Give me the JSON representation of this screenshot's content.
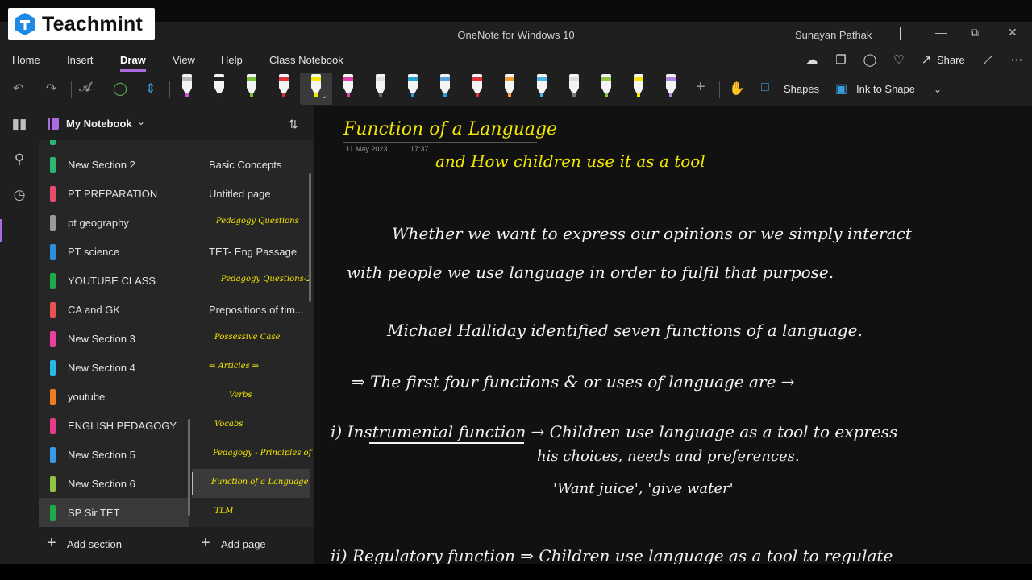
{
  "brand": {
    "name": "Teachmint"
  },
  "window": {
    "title": "OneNote for Windows 10",
    "user": "Sunayan Pathak"
  },
  "menu": [
    "Home",
    "Insert",
    "Draw",
    "View",
    "Help",
    "Class Notebook"
  ],
  "menu_active": "Draw",
  "ribbon_right": {
    "share": "Share"
  },
  "toolbar": {
    "shapes": "Shapes",
    "ink_to_shape": "Ink to Shape",
    "pens": [
      {
        "band": "#b9b9b9",
        "point": "#c35bd0"
      },
      {
        "band": "#222222",
        "point": "#222222"
      },
      {
        "band": "#7bbd3a",
        "point": "#7bbd3a"
      },
      {
        "band": "#e0303a",
        "point": "#e0303a"
      },
      {
        "band": "#f3e600",
        "point": "#f3e600"
      },
      {
        "band": "#e23fa9",
        "point": "#e23fa9"
      },
      {
        "band": "#dddddd",
        "point": "#666666"
      },
      {
        "band": "#2a9fd6",
        "point": "#2a9fd6"
      },
      {
        "band": "#5aa0e0",
        "point": "#2a9fd6"
      },
      {
        "band": "#e0303a",
        "point": "#e0303a"
      },
      {
        "band": "#f29d38",
        "point": "#f29d38"
      },
      {
        "band": "#47b6e8",
        "point": "#47b6e8"
      },
      {
        "band": "#dddddd",
        "point": "#777777"
      },
      {
        "band": "#8dc63f",
        "point": "#8dc63f"
      },
      {
        "band": "#f3e600",
        "point": "#f3e600"
      },
      {
        "band": "#b088e0",
        "point": "#b088e0"
      }
    ]
  },
  "notebook": {
    "title": "My Notebook"
  },
  "sections": [
    {
      "label": "New Section 2",
      "color": "#2bb673"
    },
    {
      "label": "PT PREPARATION",
      "color": "#e94b6d"
    },
    {
      "label": "pt geography",
      "color": "#9a9a9a"
    },
    {
      "label": "PT science",
      "color": "#2a8fe0"
    },
    {
      "label": "YOUTUBE CLASS",
      "color": "#1faa4a"
    },
    {
      "label": "CA and GK",
      "color": "#e8524f"
    },
    {
      "label": "New Section 3",
      "color": "#e83fa0"
    },
    {
      "label": "New Section 4",
      "color": "#29b6e8"
    },
    {
      "label": "youtube",
      "color": "#f07c22"
    },
    {
      "label": "ENGLISH PEDAGOGY",
      "color": "#e63b8a"
    },
    {
      "label": "New Section 5",
      "color": "#3b9ae8"
    },
    {
      "label": "New Section 6",
      "color": "#8dc63f"
    },
    {
      "label": "SP Sir TET",
      "color": "#1faa4a"
    }
  ],
  "sections_add": "Add section",
  "pages": [
    {
      "label": "Basic Concepts",
      "type": "text"
    },
    {
      "label": "Untitled page",
      "type": "text"
    },
    {
      "label": "Pedagogy Questions",
      "type": "hand"
    },
    {
      "label": "TET- Eng Passage",
      "type": "text"
    },
    {
      "label": "Pedagogy Questions-2",
      "type": "hand"
    },
    {
      "label": "Prepositions of tim...",
      "type": "text"
    },
    {
      "label": "Possessive Case",
      "type": "hand"
    },
    {
      "label": "⇐ Articles ⇒",
      "type": "hand"
    },
    {
      "label": "Verbs",
      "type": "hand"
    },
    {
      "label": "Vocabs",
      "type": "hand"
    },
    {
      "label": "Pedagogy - Principles of Lan",
      "type": "hand"
    },
    {
      "label": "Function of a Language",
      "type": "hand"
    },
    {
      "label": "TLM",
      "type": "hand"
    }
  ],
  "pages_add": "Add page",
  "note": {
    "title": "Function of a Language",
    "date": "11 May 2023",
    "time": "17:37",
    "subtitle": "and How children use it as a tool",
    "lines": [
      "Whether we want to express our opinions or we simply interact",
      "with people we use language in order to fulfil that purpose.",
      "Michael Halliday identified seven functions of a language.",
      "⇒ The first four functions & or uses of language are →",
      "i) Instrumental function → Children use language as a tool to express",
      "his choices, needs and preferences.",
      "'Want juice', 'give water'",
      "ii) Regulatory function ⇒ Children use language as a tool to regulate"
    ]
  }
}
